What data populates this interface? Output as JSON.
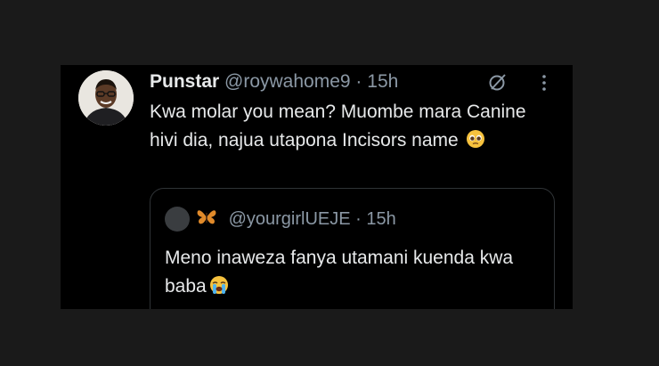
{
  "tweet": {
    "display_name": "Punstar",
    "handle": "@roywahome9",
    "separator": "·",
    "time": "15h",
    "text": "Kwa molar you mean? Muombe mara Canine hivi dia, najua utapona Incisors name",
    "emoji": "pleading-face-emoji"
  },
  "quoted": {
    "handle": "@yourgirlUEJE",
    "separator": "·",
    "time": "15h",
    "text": "Meno inaweza fanya utamani kuenda kwa baba",
    "name_emoji": "butterfly-emoji",
    "text_emoji": "crying-face-emoji"
  },
  "colors": {
    "background": "#1a1a1a",
    "card": "#000000",
    "primary_text": "#e7e9ea",
    "secondary_text": "#8b98a5",
    "border": "#2f3336"
  }
}
